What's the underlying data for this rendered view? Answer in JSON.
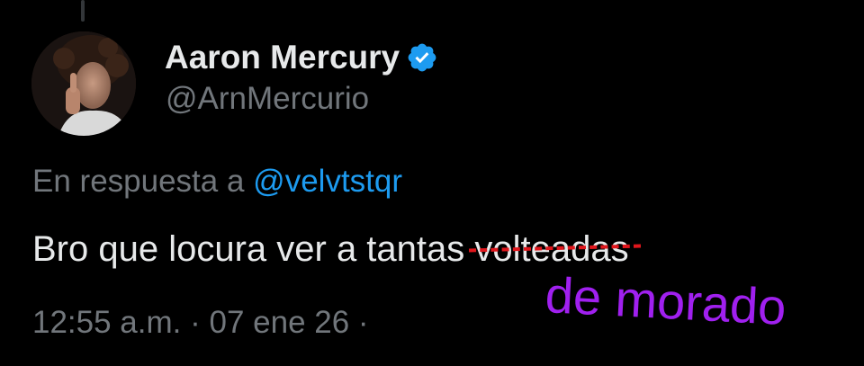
{
  "author": {
    "display_name": "Aaron Mercury",
    "handle": "@ArnMercurio",
    "verified": true,
    "avatar_icon": "profile-photo"
  },
  "reply": {
    "prefix": "En respuesta a",
    "mention": "@velvtstqr"
  },
  "tweet": {
    "text_before": "Bro que locura ver a tantas ",
    "struck_word": "volteadas"
  },
  "meta": {
    "timestamp": "12:55 a.m. · 07 ene 26 ·"
  },
  "annotation": {
    "text": "de morado",
    "color": "#a020ef",
    "strike_color": "#e0161c"
  },
  "colors": {
    "background": "#000000",
    "primary_text": "#e7e9ea",
    "secondary_text": "#71767b",
    "link": "#1d9bf0",
    "verified_badge": "#1d9bf0"
  }
}
